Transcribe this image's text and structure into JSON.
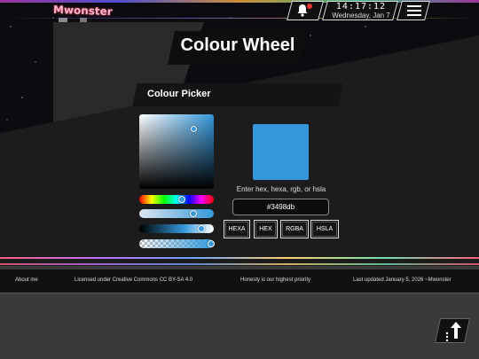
{
  "site": {
    "name": "Mwonster"
  },
  "header": {
    "clock_time": "14:17:12",
    "clock_date": "Wednesday, Jan 7",
    "icons": [
      "bell-icon",
      "menu-icon"
    ]
  },
  "page": {
    "title": "Colour Wheel"
  },
  "picker": {
    "section_title": "Colour Picker",
    "current_color": "#3498db",
    "hint": "Enter hex, hexa, rgb, or hsla",
    "input_value": "#3498db",
    "sliders": {
      "hue_fraction": 0.57,
      "saturation_fraction": 0.73,
      "lightness_fraction": 0.83,
      "alpha_fraction": 0.97
    },
    "sv_handle": {
      "saturation": 0.73,
      "value": 0.15
    },
    "format_buttons": [
      "HEXA",
      "HEX",
      "RGBA",
      "HSLA"
    ]
  },
  "footer": {
    "about": "About me",
    "license": "Licensed under Creative Commons CC BY-SA 4.0",
    "motto": "Honesty is our highest priority",
    "updated": "Last updated January 5, 2026 ~Mwonster"
  },
  "colors": {
    "accent": "#3498db",
    "alert": "#e33333"
  }
}
